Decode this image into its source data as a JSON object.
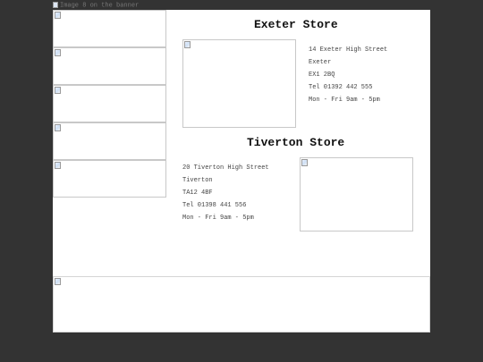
{
  "header": {
    "logo_alt": "Image 8 on the banner"
  },
  "stores": [
    {
      "title": "Exeter Store",
      "address_lines": [
        "14 Exeter High Street",
        "Exeter",
        "EX1 2BQ",
        "Tel 01392 442 555",
        "Mon - Fri 9am - 5pm"
      ]
    },
    {
      "title": "Tiverton Store",
      "address_lines": [
        "20 Tiverton High Street",
        "Tiverton",
        "TA12 4BF",
        "Tel 01398 441 556",
        "Mon - Fri 9am - 5pm"
      ]
    }
  ],
  "colors": {
    "page_background": "#333333",
    "content_background": "#ffffff",
    "placeholder_border": "#c8c8c8"
  }
}
